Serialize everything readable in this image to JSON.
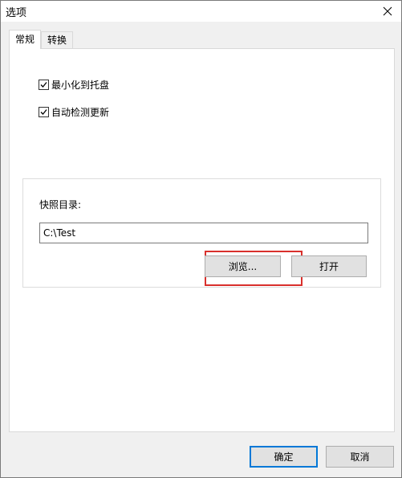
{
  "window": {
    "title": "选项"
  },
  "tabs": [
    {
      "label": "常规",
      "active": true
    },
    {
      "label": "转换",
      "active": false
    }
  ],
  "general": {
    "minimize_to_tray": {
      "label": "最小化到托盘",
      "checked": true
    },
    "auto_check_update": {
      "label": "自动检测更新",
      "checked": true
    },
    "snapshot": {
      "label": "快照目录:",
      "path_value": "C:\\Test",
      "browse_label": "浏览...",
      "open_label": "打开"
    }
  },
  "footer": {
    "ok_label": "确定",
    "cancel_label": "取消"
  },
  "colors": {
    "accent": "#0078d7",
    "highlight": "#d9302c"
  }
}
